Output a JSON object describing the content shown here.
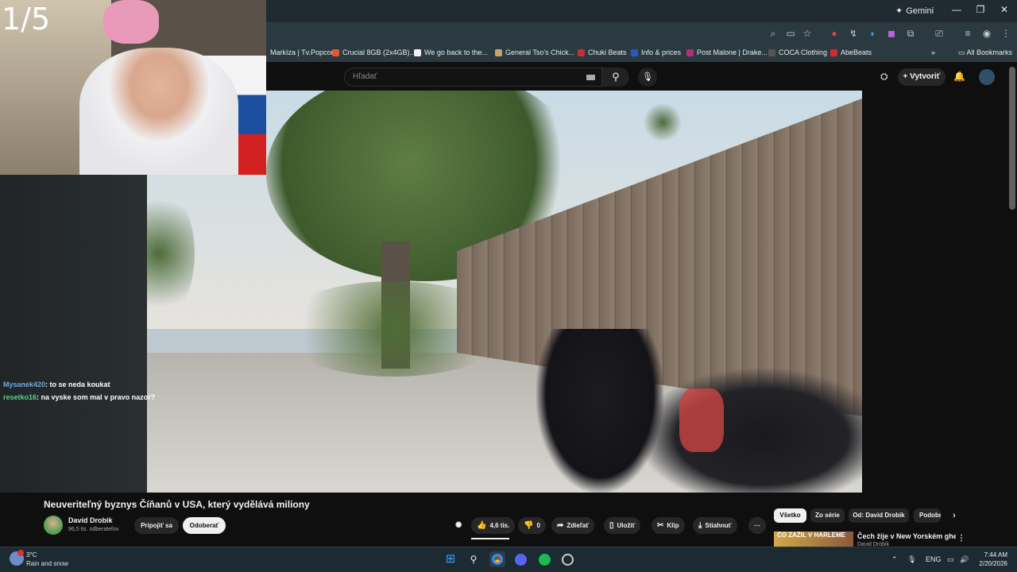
{
  "browser": {
    "gemini_label": "Gemini",
    "bookmarks": [
      {
        "label": "Markíza | Tv.Popcor...",
        "color": "#2b3a41"
      },
      {
        "label": "Crucial 8GB (2x4GB)...",
        "color": "#e4572e"
      },
      {
        "label": "We go back to the...",
        "color": "#f1f1f1"
      },
      {
        "label": "General Tso's Chick...",
        "color": "#c8a26b"
      },
      {
        "label": "Chuki Beats",
        "color": "#c2303a"
      },
      {
        "label": "Info & prices",
        "color": "#2a57c7"
      },
      {
        "label": "Post Malone | Drake...",
        "color": "#b03070"
      },
      {
        "label": "COCA Clothing",
        "color": "#333333"
      },
      {
        "label": "AbeBeats",
        "color": "#d12b2b"
      }
    ],
    "all_bookmarks": "All Bookmarks"
  },
  "youtube": {
    "search_placeholder": "Hľadať",
    "create_label": "Vytvoriť",
    "video_title": "Neuveriteľný byznys Číňanů v USA, který vydělává miliony",
    "channel_name": "David Drobik",
    "channel_subs": "96,5 tis. odberateľov",
    "join_label": "Pripojiť sa",
    "unsubscribe_label": "Odoberať",
    "like_count": "4,6 tis.",
    "dislike_count": "0",
    "share_label": "Zdieľať",
    "save_label": "Uložiť",
    "clip_label": "Klip",
    "download_label": "Stiahnuť",
    "chips": [
      "Všetko",
      "Zo série",
      "Od: David Drobik",
      "Podobné"
    ],
    "rec_thumb_text": "ČO ZAŽIL V HARLEME",
    "rec_title": "Čech žije v New Yorském ghettu",
    "rec_channel": "David Drobik"
  },
  "stream": {
    "counter": "1/5",
    "chat": [
      {
        "user": "Mysanek420",
        "msg": ": to se neda koukat"
      },
      {
        "user": "resetko16",
        "msg": ": na vyske som mal v pravo nazor?"
      }
    ]
  },
  "taskbar": {
    "temp": "3°C",
    "weather": "Rain and snow",
    "lang": "ENG",
    "time": "7:44 AM",
    "date": "2/20/2026"
  }
}
